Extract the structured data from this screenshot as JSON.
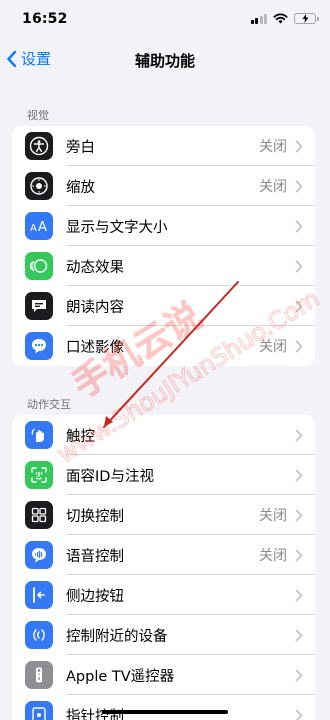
{
  "status": {
    "time": "16:52"
  },
  "nav": {
    "back_label": "设置",
    "title": "辅助功能"
  },
  "sections": [
    {
      "header": "视觉",
      "items": [
        {
          "label": "旁白",
          "value": "关闭",
          "icon": "voiceover-icon",
          "color": "#1c1c1e"
        },
        {
          "label": "缩放",
          "value": "关闭",
          "icon": "zoom-icon",
          "color": "#1c1c1e"
        },
        {
          "label": "显示与文字大小",
          "value": "",
          "icon": "text-size-icon",
          "color": "#3478f6"
        },
        {
          "label": "动态效果",
          "value": "",
          "icon": "motion-icon",
          "color": "#34c759"
        },
        {
          "label": "朗读内容",
          "value": "",
          "icon": "speech-icon",
          "color": "#1c1c1e"
        },
        {
          "label": "口述影像",
          "value": "关闭",
          "icon": "audio-description-icon",
          "color": "#3478f6"
        }
      ]
    },
    {
      "header": "动作交互",
      "items": [
        {
          "label": "触控",
          "value": "",
          "icon": "touch-icon",
          "color": "#3478f6"
        },
        {
          "label": "面容ID与注视",
          "value": "",
          "icon": "face-id-icon",
          "color": "#34c759"
        },
        {
          "label": "切换控制",
          "value": "关闭",
          "icon": "switch-control-icon",
          "color": "#1c1c1e"
        },
        {
          "label": "语音控制",
          "value": "关闭",
          "icon": "voice-control-icon",
          "color": "#3478f6"
        },
        {
          "label": "侧边按钮",
          "value": "",
          "icon": "side-button-icon",
          "color": "#3478f6"
        },
        {
          "label": "控制附近的设备",
          "value": "",
          "icon": "nearby-devices-icon",
          "color": "#3478f6"
        },
        {
          "label": "Apple TV遥控器",
          "value": "",
          "icon": "apple-tv-remote-icon",
          "color": "#8e8e93"
        },
        {
          "label": "指针控制",
          "value": "",
          "icon": "pointer-control-icon",
          "color": "#3478f6"
        }
      ]
    }
  ],
  "watermark": {
    "text": "手机云说",
    "url": "www.ShouJiYunShuo.Com",
    "color": "#ff3b30"
  }
}
